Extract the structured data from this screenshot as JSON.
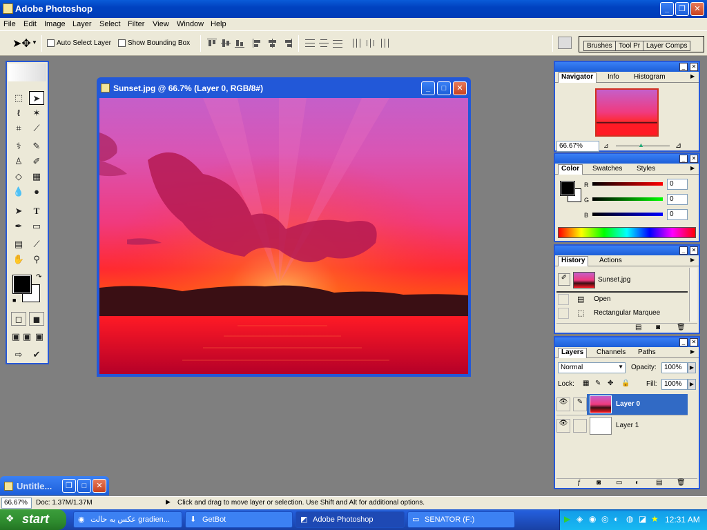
{
  "app": {
    "title": "Adobe Photoshop"
  },
  "menu": [
    "File",
    "Edit",
    "Image",
    "Layer",
    "Select",
    "Filter",
    "View",
    "Window",
    "Help"
  ],
  "options": {
    "auto_select": "Auto Select Layer",
    "show_bounding": "Show Bounding Box",
    "palette_well": [
      "Brushes",
      "Tool Pr",
      "Layer Comps"
    ]
  },
  "document": {
    "title": "Sunset.jpg @ 66.7% (Layer 0, RGB/8#)"
  },
  "minimized_doc": {
    "title": "Untitle..."
  },
  "navigator": {
    "tabs": [
      "Navigator",
      "Info",
      "Histogram"
    ],
    "zoom": "66.67%"
  },
  "color": {
    "tabs": [
      "Color",
      "Swatches",
      "Styles"
    ],
    "r_label": "R",
    "g_label": "G",
    "b_label": "B",
    "r": "0",
    "g": "0",
    "b": "0"
  },
  "history": {
    "tabs": [
      "History",
      "Actions"
    ],
    "snapshot": "Sunset.jpg",
    "items": [
      "Open",
      "Rectangular Marquee"
    ]
  },
  "layers": {
    "tabs": [
      "Layers",
      "Channels",
      "Paths"
    ],
    "blend_mode": "Normal",
    "opacity_label": "Opacity:",
    "opacity": "100%",
    "lock_label": "Lock:",
    "fill_label": "Fill:",
    "fill": "100%",
    "rows": [
      {
        "name": "Layer 0",
        "selected": true
      },
      {
        "name": "Layer 1",
        "selected": false
      }
    ]
  },
  "status": {
    "zoom": "66.67%",
    "doc": "Doc: 1.37M/1.37M",
    "hint": "Click and drag to move layer or selection.  Use Shift and Alt for additional options."
  },
  "taskbar": {
    "start": "start",
    "tasks": [
      "عکس به حالت gradien...",
      "GetBot",
      "Adobe Photoshop",
      "SENATOR (F:)"
    ],
    "clock": "12:31 AM"
  }
}
